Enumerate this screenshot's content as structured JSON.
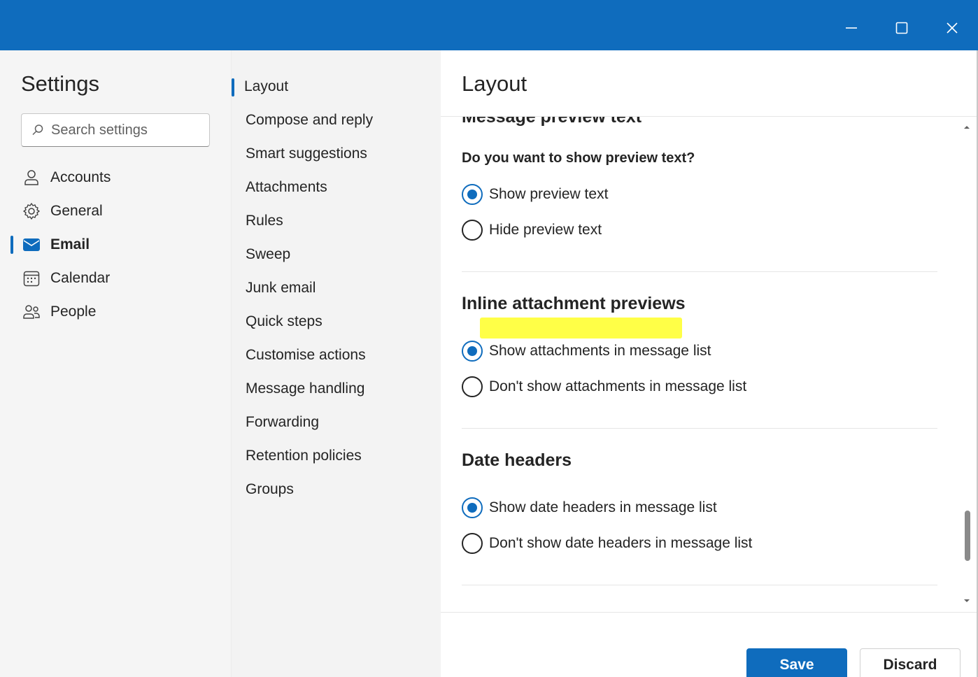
{
  "window": {
    "controls": {
      "minimize": "minimize-icon",
      "maximize": "maximize-icon",
      "close": "close-icon"
    },
    "accent": "#0f6cbd"
  },
  "leftnav": {
    "title": "Settings",
    "search_placeholder": "Search settings",
    "items": [
      {
        "label": "Accounts",
        "icon": "person-icon"
      },
      {
        "label": "General",
        "icon": "gear-icon"
      },
      {
        "label": "Email",
        "icon": "mail-icon",
        "active": true
      },
      {
        "label": "Calendar",
        "icon": "calendar-icon"
      },
      {
        "label": "People",
        "icon": "people-icon"
      }
    ]
  },
  "subnav": {
    "items": [
      {
        "label": "Layout",
        "active": true
      },
      {
        "label": "Compose and reply"
      },
      {
        "label": "Smart suggestions"
      },
      {
        "label": "Attachments"
      },
      {
        "label": "Rules"
      },
      {
        "label": "Sweep"
      },
      {
        "label": "Junk email"
      },
      {
        "label": "Quick steps"
      },
      {
        "label": "Customise actions"
      },
      {
        "label": "Message handling"
      },
      {
        "label": "Forwarding"
      },
      {
        "label": "Retention policies"
      },
      {
        "label": "Groups"
      }
    ]
  },
  "content": {
    "title": "Layout",
    "sections": [
      {
        "heading": "Message preview text",
        "question": "Do you want to show preview text?",
        "options": [
          {
            "label": "Show preview text",
            "checked": true
          },
          {
            "label": "Hide preview text",
            "checked": false
          }
        ]
      },
      {
        "heading": "Inline attachment previews",
        "options": [
          {
            "label": "Show attachments in message list",
            "checked": true
          },
          {
            "label": "Don't show attachments in message list",
            "checked": false
          }
        ]
      },
      {
        "heading": "Date headers",
        "options": [
          {
            "label": "Show date headers in message list",
            "checked": true
          },
          {
            "label": "Don't show date headers in message list",
            "checked": false
          }
        ]
      }
    ],
    "highlight_color": "#ffff33"
  },
  "footer": {
    "save_label": "Save",
    "discard_label": "Discard"
  }
}
